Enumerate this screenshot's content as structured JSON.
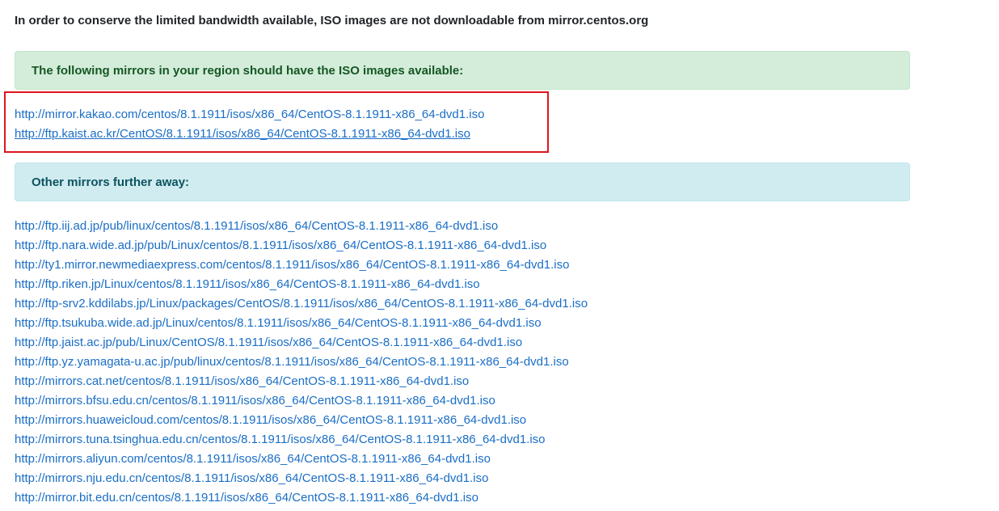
{
  "notice": "In order to conserve the limited bandwidth available, ISO images are not downloadable from mirror.centos.org",
  "nearby": {
    "heading": "The following mirrors in your region should have the ISO images available:",
    "links": [
      "http://mirror.kakao.com/centos/8.1.1911/isos/x86_64/CentOS-8.1.1911-x86_64-dvd1.iso",
      "http://ftp.kaist.ac.kr/CentOS/8.1.1911/isos/x86_64/CentOS-8.1.1911-x86_64-dvd1.iso"
    ]
  },
  "further": {
    "heading": "Other mirrors further away:",
    "links": [
      "http://ftp.iij.ad.jp/pub/linux/centos/8.1.1911/isos/x86_64/CentOS-8.1.1911-x86_64-dvd1.iso",
      "http://ftp.nara.wide.ad.jp/pub/Linux/centos/8.1.1911/isos/x86_64/CentOS-8.1.1911-x86_64-dvd1.iso",
      "http://ty1.mirror.newmediaexpress.com/centos/8.1.1911/isos/x86_64/CentOS-8.1.1911-x86_64-dvd1.iso",
      "http://ftp.riken.jp/Linux/centos/8.1.1911/isos/x86_64/CentOS-8.1.1911-x86_64-dvd1.iso",
      "http://ftp-srv2.kddilabs.jp/Linux/packages/CentOS/8.1.1911/isos/x86_64/CentOS-8.1.1911-x86_64-dvd1.iso",
      "http://ftp.tsukuba.wide.ad.jp/Linux/centos/8.1.1911/isos/x86_64/CentOS-8.1.1911-x86_64-dvd1.iso",
      "http://ftp.jaist.ac.jp/pub/Linux/CentOS/8.1.1911/isos/x86_64/CentOS-8.1.1911-x86_64-dvd1.iso",
      "http://ftp.yz.yamagata-u.ac.jp/pub/linux/centos/8.1.1911/isos/x86_64/CentOS-8.1.1911-x86_64-dvd1.iso",
      "http://mirrors.cat.net/centos/8.1.1911/isos/x86_64/CentOS-8.1.1911-x86_64-dvd1.iso",
      "http://mirrors.bfsu.edu.cn/centos/8.1.1911/isos/x86_64/CentOS-8.1.1911-x86_64-dvd1.iso",
      "http://mirrors.huaweicloud.com/centos/8.1.1911/isos/x86_64/CentOS-8.1.1911-x86_64-dvd1.iso",
      "http://mirrors.tuna.tsinghua.edu.cn/centos/8.1.1911/isos/x86_64/CentOS-8.1.1911-x86_64-dvd1.iso",
      "http://mirrors.aliyun.com/centos/8.1.1911/isos/x86_64/CentOS-8.1.1911-x86_64-dvd1.iso",
      "http://mirrors.nju.edu.cn/centos/8.1.1911/isos/x86_64/CentOS-8.1.1911-x86_64-dvd1.iso",
      "http://mirror.bit.edu.cn/centos/8.1.1911/isos/x86_64/CentOS-8.1.1911-x86_64-dvd1.iso"
    ]
  },
  "colors": {
    "link": "#1a6ec6",
    "success_bg": "#d4edda",
    "success_text": "#155724",
    "info_bg": "#d1ecf1",
    "info_text": "#0c5460",
    "annotation_box": "#e0141e"
  }
}
